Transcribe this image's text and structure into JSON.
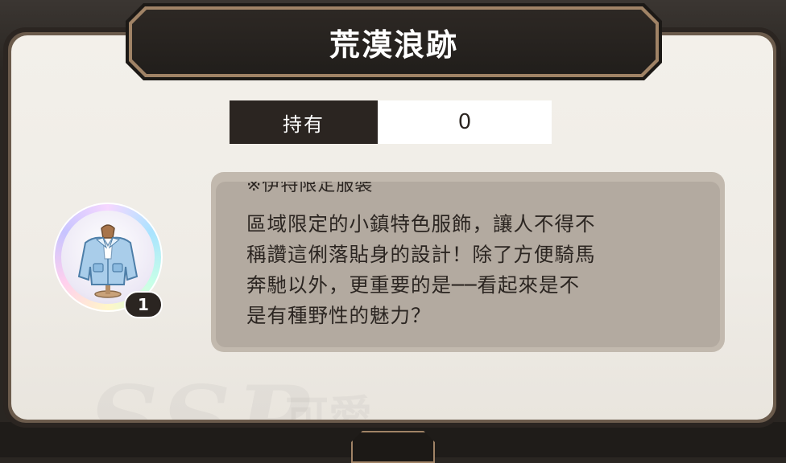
{
  "dialog": {
    "title": "荒漠浪跡",
    "owned_label": "持有",
    "owned_value": "0"
  },
  "item": {
    "icon": "jacket-icon",
    "quantity": "1",
    "note": "※伊特限定服裝",
    "description_lines": [
      "區域限定的小鎮特色服飾，讓人不得不",
      "稱讚這俐落貼身的設計！除了方便騎馬",
      "奔馳以外，更重要的是──看起來是不",
      "是有種野性的魅力？"
    ]
  },
  "watermark": {
    "text": "SSR",
    "subtext": "可愛"
  },
  "colors": {
    "panel_bg": "#efece6",
    "dark": "#2b2521",
    "gold": "#a08366",
    "desc_bg": "#b3aaa0"
  }
}
